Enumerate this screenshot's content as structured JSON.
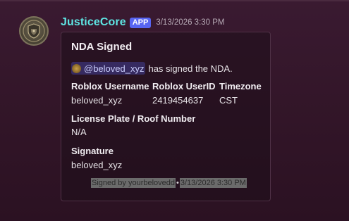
{
  "message": {
    "author": "JusticeCore",
    "badge": "APP",
    "timestamp": "3/13/2026 3:30 PM",
    "avatar_icon": "shield-badge-icon"
  },
  "embed": {
    "title": "NDA Signed",
    "mention": "@beloved_xyz",
    "description": "has signed the NDA.",
    "fields": {
      "roblox_username": {
        "name": "Roblox Username",
        "value": "beloved_xyz"
      },
      "roblox_userid": {
        "name": "Roblox UserID",
        "value": "2419454637"
      },
      "timezone": {
        "name": "Timezone",
        "value": "CST"
      },
      "license_plate": {
        "name": "License Plate / Roof Number",
        "value": "N/A"
      },
      "signature": {
        "name": "Signature",
        "value": "beloved_xyz"
      }
    },
    "footer": {
      "text": "Signed by yourbelovedd",
      "separator": "•",
      "timestamp": "3/13/2026 3:30 PM"
    }
  },
  "colors": {
    "author": "#5ee6e4",
    "app_badge": "#5865f2",
    "background": "#331629"
  }
}
